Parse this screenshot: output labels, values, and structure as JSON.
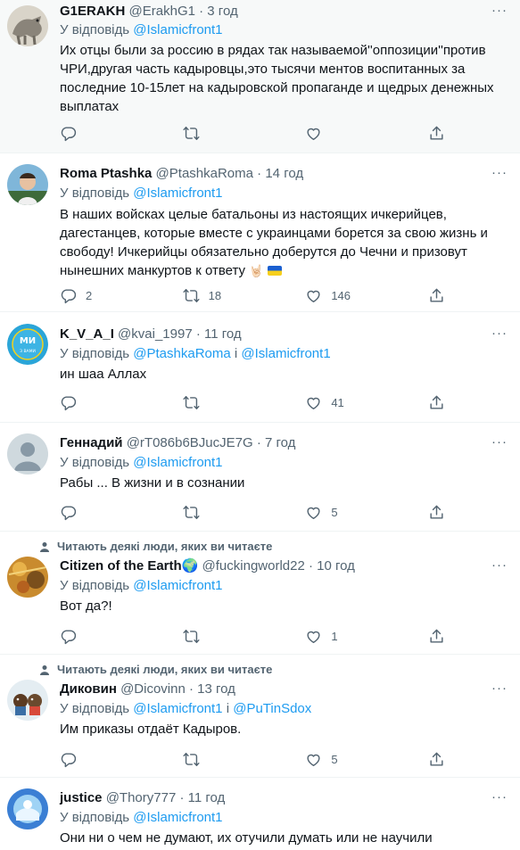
{
  "ui": {
    "reply_prefix": "У відповідь",
    "and_word": "і",
    "more_glyph": "···",
    "social_context": "Читають деякі люди, яких ви читаєте"
  },
  "tweets": [
    {
      "name": "G1ERAKH",
      "handle": "@ErakhG1",
      "time": "3 год",
      "reply_to": [
        "@Islamicfront1"
      ],
      "text": "Их отцы были за россию в рядах так называемой''оппозиции''против ЧРИ,другая часть кадыровцы,это тысячи ментов воспитанных за последние 10-15лет на кадыровской пропаганде и щедрых денежных выплатах",
      "replies": "",
      "retweets": "",
      "likes": ""
    },
    {
      "name": "Roma Ptashka",
      "handle": "@PtashkaRoma",
      "time": "14 год",
      "reply_to": [
        "@Islamicfront1"
      ],
      "text": "В наших войсках целые батальоны из настоящих ичкерийцев, дагестанцев, которые вместе с украинцами борется за свою жизнь и свободу! Ичкерийцы обязательно доберутся до Чечни и призовут нынешних манкуртов к ответу",
      "emoji": "🤘🏻",
      "replies": "2",
      "retweets": "18",
      "likes": "146"
    },
    {
      "name": "K_V_A_I",
      "handle": "@kvai_1997",
      "time": "11 год",
      "reply_to": [
        "@PtashkaRoma",
        "@Islamicfront1"
      ],
      "text": "ин шаа Аллах",
      "avatar_text": [
        "МИ",
        "З ВАМИ"
      ],
      "replies": "",
      "retweets": "",
      "likes": "41"
    },
    {
      "name": "Геннадий",
      "handle": "@rT086b6BJucJE7G",
      "time": "7 год",
      "reply_to": [
        "@Islamicfront1"
      ],
      "text": "Рабы ... В жизни и в сознании",
      "replies": "",
      "retweets": "",
      "likes": "5"
    },
    {
      "name": "Citizen of the Earth",
      "handle": "@fuckingworld22",
      "time": "10 год",
      "reply_to": [
        "@Islamicfront1"
      ],
      "text": "Вот да?!",
      "replies": "",
      "retweets": "",
      "likes": "1"
    },
    {
      "name": "Диковин",
      "handle": "@Dicovinn",
      "time": "13 год",
      "reply_to": [
        "@Islamicfront1",
        "@PuTinSdox"
      ],
      "text": "Им приказы отдаёт Кадыров.",
      "replies": "",
      "retweets": "",
      "likes": "5"
    },
    {
      "name": "justice",
      "handle": "@Thory777",
      "time": "11 год",
      "reply_to": [
        "@Islamicfront1"
      ],
      "text": "Они ни о чем не думают, их отучили думать или не научили"
    }
  ],
  "colors": {
    "link": "#1d9bf0",
    "muted": "#536471",
    "text": "#0f1419",
    "highlight_bg": "#f7f9f9"
  },
  "icons": [
    "reply-icon",
    "retweet-icon",
    "like-icon",
    "share-icon",
    "more-icon",
    "person-icon",
    "globe-emoji",
    "ukraine-flag"
  ]
}
